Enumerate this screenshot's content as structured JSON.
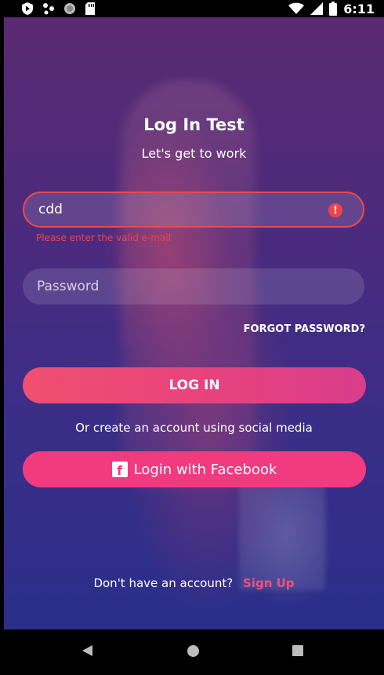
{
  "status_bar": {
    "time": "6:11",
    "icons": [
      "play-protect-icon",
      "notification-dots-icon",
      "circle-icon",
      "sd-card-icon",
      "wifi-icon",
      "cellular-signal-icon",
      "battery-icon"
    ]
  },
  "login": {
    "title": "Log In Test",
    "subtitle": "Let's get to work",
    "email_value": "cdd",
    "email_error": "Please enter the valid e-mail",
    "error_icon": "!",
    "password_placeholder": "Password",
    "forgot_label": "FORGOT PASSWORD?",
    "login_button": "LOG IN",
    "social_text": "Or create an account using social media",
    "facebook_icon": "f",
    "facebook_button": "Login with Facebook",
    "no_account_text": "Don't have an account?",
    "signup_link": "Sign Up"
  },
  "colors": {
    "error": "#f0434b",
    "accent_pink": "#f23a7e",
    "background_purple": "#4b2a7d"
  },
  "nav_bar": {
    "icons": [
      "back-icon",
      "home-icon",
      "recents-icon"
    ]
  }
}
